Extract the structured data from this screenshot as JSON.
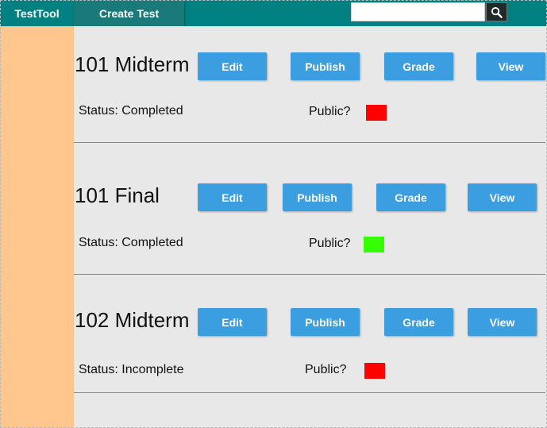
{
  "app": {
    "brand": "TestTool",
    "nav_create": "Create Test",
    "search": {
      "value": "",
      "placeholder": ""
    },
    "colors": {
      "topbar": "#008080",
      "sidebar": "#ffc68e",
      "button": "#3a9ee0",
      "public_false": "#ff0000",
      "public_true": "#33ff00"
    }
  },
  "tests": [
    {
      "title": "101 Midterm",
      "buttons": {
        "edit": "Edit",
        "publish": "Publish",
        "grade": "Grade",
        "view": "View"
      },
      "status": "Status: Completed",
      "public_label": "Public?",
      "public": false
    },
    {
      "title": "101 Final",
      "buttons": {
        "edit": "Edit",
        "publish": "Publish",
        "grade": "Grade",
        "view": "View"
      },
      "status": "Status: Completed",
      "public_label": "Public?",
      "public": true
    },
    {
      "title": "102 Midterm",
      "buttons": {
        "edit": "Edit",
        "publish": "Publish",
        "grade": "Grade",
        "view": "View"
      },
      "status": "Status: Incomplete",
      "public_label": "Public?",
      "public": false
    }
  ]
}
